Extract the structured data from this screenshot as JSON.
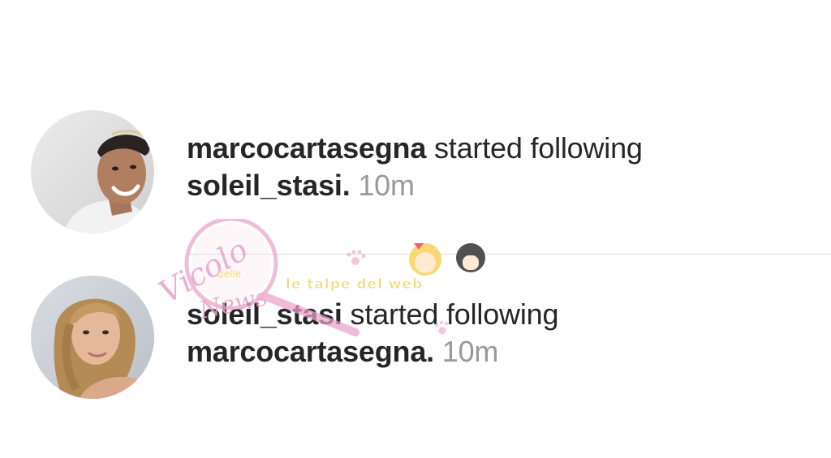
{
  "notifications": [
    {
      "user": "marcocartasegna",
      "action": "started following",
      "target": "soleil_stasi.",
      "time": "10m"
    },
    {
      "user": "soleil_stasi",
      "action": "started following",
      "target": "marcocartasegna.",
      "time": "10m"
    }
  ],
  "watermark": {
    "line1": "Vicolo",
    "line2": "delle",
    "line3": "News",
    "tagline": "le talpe del web"
  },
  "colors": {
    "username": "#262626",
    "timestamp": "#999999",
    "divider": "#dbdbdb",
    "watermark_pink": "#e8a3c9",
    "watermark_yellow": "#f6d25a"
  }
}
